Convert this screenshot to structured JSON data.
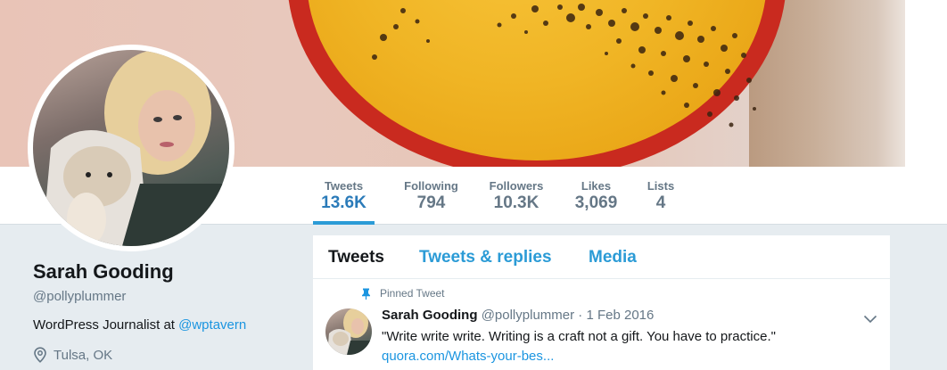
{
  "stats": [
    {
      "label": "Tweets",
      "value": "13.6K"
    },
    {
      "label": "Following",
      "value": "794"
    },
    {
      "label": "Followers",
      "value": "10.3K"
    },
    {
      "label": "Likes",
      "value": "3,069"
    },
    {
      "label": "Lists",
      "value": "4"
    }
  ],
  "profile": {
    "name": "Sarah Gooding",
    "handle": "@pollyplummer",
    "bio_text": "WordPress Journalist at ",
    "bio_link": "@wptavern",
    "location": "Tulsa, OK"
  },
  "tabs": {
    "tweets": "Tweets",
    "replies": "Tweets & replies",
    "media": "Media"
  },
  "tweet": {
    "pinned_label": "Pinned Tweet",
    "name": "Sarah Gooding",
    "handle": "@pollyplummer",
    "separator": "·",
    "date": "1 Feb 2016",
    "text": "\"Write write write. Writing is a craft not a gift. You have to practice.\"",
    "link": "quora.com/Whats-your-bes..."
  },
  "colors": {
    "accent": "#1da1f2",
    "link": "#1b95e0",
    "muted": "#657786",
    "background": "#e6ecf0"
  },
  "icons": {
    "pin": "pin-icon",
    "location": "location-pin-icon",
    "caret": "chevron-down-icon"
  }
}
